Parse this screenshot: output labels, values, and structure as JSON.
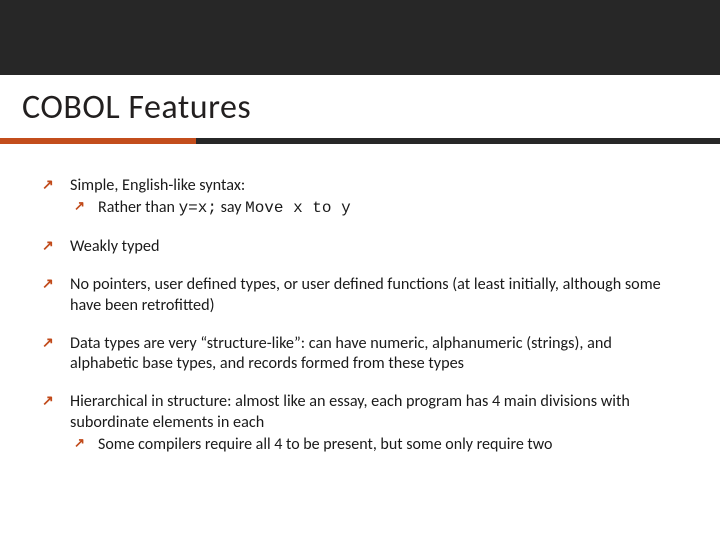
{
  "title": "COBOL Features",
  "bullets": {
    "b1": {
      "text": "Simple, English-like syntax:",
      "sub1_pre": "Rather than ",
      "sub1_code1": "y=x;",
      "sub1_mid": " say ",
      "sub1_code2": "Move x to y"
    },
    "b2": "Weakly typed",
    "b3": "No pointers, user defined types, or user defined functions (at least initially, although some have been retrofitted)",
    "b4": "Data types are very “structure-like”: can have numeric, alphanumeric (strings), and alphabetic base types, and records formed from these types",
    "b5": {
      "text": "Hierarchical in structure: almost like an essay, each program has 4 main divisions with subordinate elements in each",
      "sub1": "Some compilers require all 4 to be present, but some only require two"
    }
  }
}
